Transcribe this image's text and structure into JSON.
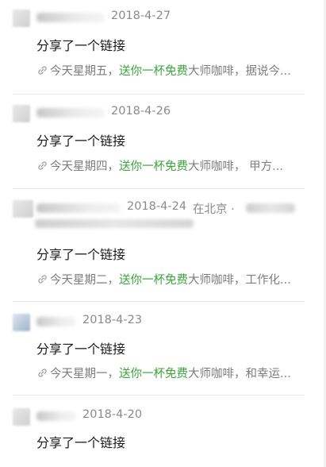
{
  "posts": [
    {
      "date": "2018-4-27",
      "location": "",
      "title": "分享了一个链接",
      "link_prefix": "今天星期五，",
      "link_highlight": "送你一杯免费",
      "link_suffix": "大师咖啡，据说今..."
    },
    {
      "date": "2018-4-26",
      "location": "",
      "title": "分享了一个链接",
      "link_prefix": "今天星期四，",
      "link_highlight": "送你一杯免费",
      "link_suffix": "大师咖啡， 甲方..."
    },
    {
      "date": "2018-4-24",
      "location": "在北京 ·",
      "title": "分享了一个链接",
      "link_prefix": "今天星期二，",
      "link_highlight": "送你一杯免费",
      "link_suffix": "大师咖啡，工作化..."
    },
    {
      "date": "2018-4-23",
      "location": "",
      "title": "分享了一个链接",
      "link_prefix": "今天星期一，",
      "link_highlight": "送你一杯免费",
      "link_suffix": "大师咖啡，和幸运..."
    },
    {
      "date": "2018-4-20",
      "location": "",
      "title": "分享了一个链接",
      "link_prefix": "",
      "link_highlight": "",
      "link_suffix": ""
    }
  ],
  "colors": {
    "highlight": "#3aa53a",
    "meta_text": "#8a8a8a",
    "body_text": "#1a1a1a",
    "divider": "#e8e8e8"
  },
  "icons": {
    "link": "link-icon"
  }
}
